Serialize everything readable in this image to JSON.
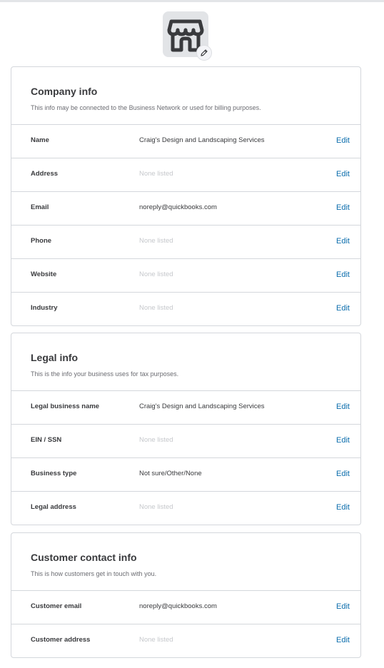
{
  "company_info": {
    "title": "Company info",
    "subtitle": "This info may be connected to the Business Network or used for billing purposes.",
    "rows": [
      {
        "label": "Name",
        "value": "Craig's Design and Landscaping Services",
        "empty": false,
        "edit": "Edit"
      },
      {
        "label": "Address",
        "value": "None listed",
        "empty": true,
        "edit": "Edit"
      },
      {
        "label": "Email",
        "value": "noreply@quickbooks.com",
        "empty": false,
        "edit": "Edit"
      },
      {
        "label": "Phone",
        "value": "None listed",
        "empty": true,
        "edit": "Edit"
      },
      {
        "label": "Website",
        "value": "None listed",
        "empty": true,
        "edit": "Edit"
      },
      {
        "label": "Industry",
        "value": "None listed",
        "empty": true,
        "edit": "Edit"
      }
    ]
  },
  "legal_info": {
    "title": "Legal info",
    "subtitle": "This is the info your business uses for tax purposes.",
    "rows": [
      {
        "label": "Legal business name",
        "value": "Craig's Design and Landscaping Services",
        "empty": false,
        "edit": "Edit"
      },
      {
        "label": "EIN / SSN",
        "value": "None listed",
        "empty": true,
        "edit": "Edit"
      },
      {
        "label": "Business type",
        "value": "Not sure/Other/None",
        "empty": false,
        "edit": "Edit"
      },
      {
        "label": "Legal address",
        "value": "None listed",
        "empty": true,
        "edit": "Edit"
      }
    ]
  },
  "customer_contact_info": {
    "title": "Customer contact info",
    "subtitle": "This is how customers get in touch with you.",
    "rows": [
      {
        "label": "Customer email",
        "value": "noreply@quickbooks.com",
        "empty": false,
        "edit": "Edit"
      },
      {
        "label": "Customer address",
        "value": "None listed",
        "empty": true,
        "edit": "Edit"
      }
    ]
  },
  "icons": {
    "logo": "storefront-icon",
    "logo_edit": "pencil-icon"
  },
  "colors": {
    "link": "#0d6ead",
    "border": "#d4d7dc",
    "placeholder": "#c6c8cc",
    "text": "#393a3d"
  }
}
